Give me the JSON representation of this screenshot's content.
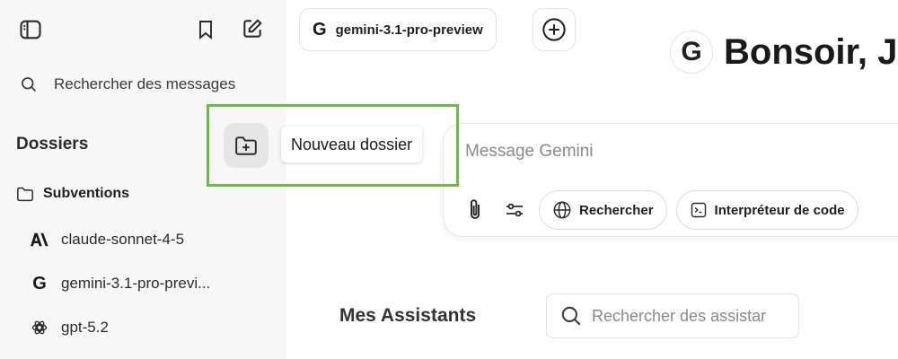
{
  "sidebar": {
    "search_label": "Rechercher des messages",
    "folders_heading": "Dossiers",
    "folder": {
      "label": "Subventions",
      "icon": "folder-icon"
    },
    "chats": [
      {
        "label": "claude-sonnet-4-5",
        "icon": "anthropic-icon"
      },
      {
        "label": "gemini-3.1-pro-previ...",
        "icon": "google-icon"
      },
      {
        "label": "gpt-5.2",
        "icon": "openai-icon"
      }
    ]
  },
  "tooltip": {
    "text": "Nouveau dossier"
  },
  "topbar": {
    "model": "gemini-3.1-pro-preview"
  },
  "greeting": {
    "text": "Bonsoir, J"
  },
  "composer": {
    "placeholder": "Message Gemini",
    "search_label": "Rechercher",
    "code_label": "Interpréteur de code"
  },
  "assistants": {
    "title": "Mes Assistants",
    "search_placeholder": "Rechercher des assistar"
  },
  "colors": {
    "highlight": "#6cbb45",
    "sidebar_bg": "#f7f7f7"
  }
}
